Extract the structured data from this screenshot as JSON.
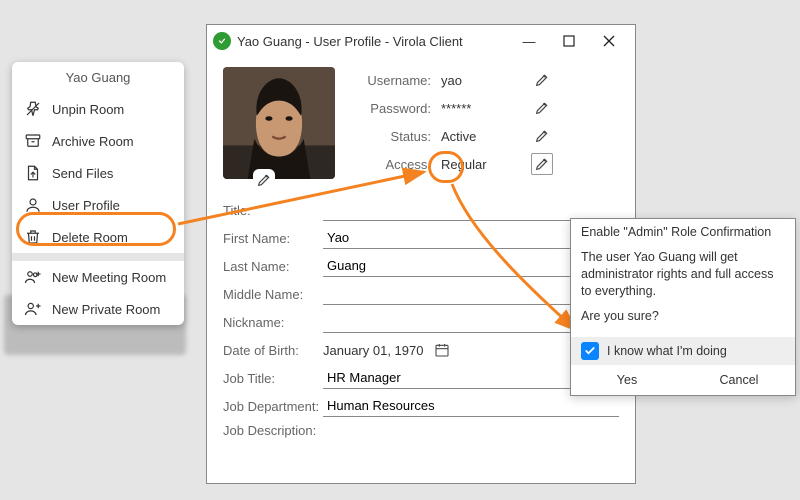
{
  "window": {
    "title": "Yao Guang - User Profile - Virola Client"
  },
  "context_menu": {
    "title": "Yao Guang",
    "items": [
      {
        "label": "Unpin Room",
        "icon": "pin-off-icon"
      },
      {
        "label": "Archive Room",
        "icon": "archive-icon"
      },
      {
        "label": "Send Files",
        "icon": "send-file-icon"
      },
      {
        "label": "User Profile",
        "icon": "user-icon"
      },
      {
        "label": "Delete Room",
        "icon": "trash-icon"
      }
    ],
    "extra": [
      {
        "label": "New Meeting Room",
        "icon": "users-plus-icon"
      },
      {
        "label": "New Private Room",
        "icon": "user-plus-icon"
      }
    ]
  },
  "credentials": {
    "username_label": "Username:",
    "username": "yao",
    "password_label": "Password:",
    "password": "******",
    "status_label": "Status:",
    "status": "Active",
    "access_label": "Access:",
    "access": "Regular"
  },
  "form": {
    "title_label": "Title:",
    "title": "",
    "first_label": "First Name:",
    "first": "Yao",
    "last_label": "Last Name:",
    "last": "Guang",
    "middle_label": "Middle Name:",
    "middle": "",
    "nick_label": "Nickname:",
    "nick": "",
    "dob_label": "Date of Birth:",
    "dob": "January 01, 1970",
    "jobtitle_label": "Job Title:",
    "jobtitle": "HR Manager",
    "jobdept_label": "Job Department:",
    "jobdept": "Human Resources",
    "jobdesc_label": "Job Description:"
  },
  "dialog": {
    "title": "Enable \"Admin\" Role Confirmation",
    "body": "The user Yao Guang will get administrator rights and full access to everything.",
    "question": "Are you sure?",
    "checkbox": "I know what I'm doing",
    "yes": "Yes",
    "cancel": "Cancel"
  },
  "colors": {
    "accent": "#f58220",
    "check": "#0a84ff",
    "ok": "#2e9b33"
  }
}
